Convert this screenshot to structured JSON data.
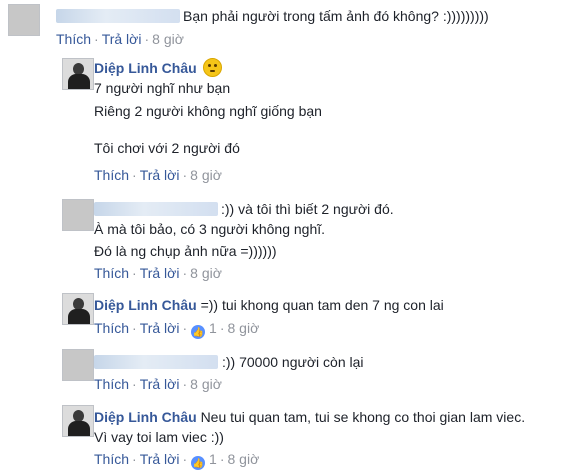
{
  "labels": {
    "like": "Thích",
    "reply": "Trả lời"
  },
  "comments": [
    {
      "time": "8 giờ",
      "text_lines": [
        "Bạn phải người trong tấm ảnh đó không? :)))))))))"
      ]
    },
    {
      "author": "Diệp Linh Châu",
      "time": "8 giờ",
      "text_lines": [
        "7 người nghĩ như bạn",
        "Riêng 2 người không nghĩ giống bạn",
        "Tôi chơi với 2 người đó"
      ],
      "emoji": "smiley-emoji"
    },
    {
      "time": "8 giờ",
      "text_lines": [
        ":)) và tôi thì biết 2 người đó.",
        "À mà tôi bảo, có 3 người không nghĩ.",
        "Đó là ng chụp ảnh nữa =))))))"
      ]
    },
    {
      "author": "Diệp Linh Châu",
      "time": "8 giờ",
      "text_lines": [
        "=)) tui khong quan tam den 7 ng con lai"
      ],
      "likes": "1"
    },
    {
      "time": "8 giờ",
      "text_lines": [
        ":)) 70000 người còn lại"
      ]
    },
    {
      "author": "Diệp Linh Châu",
      "time": "8 giờ",
      "text_lines": [
        "Neu tui quan tam, tui se khong co thoi gian lam viec.",
        "Vì vay toi lam viec :))"
      ],
      "likes": "1"
    }
  ],
  "colors": {
    "link": "#365899",
    "muted": "#90949c",
    "like_badge": "#5890ff"
  }
}
